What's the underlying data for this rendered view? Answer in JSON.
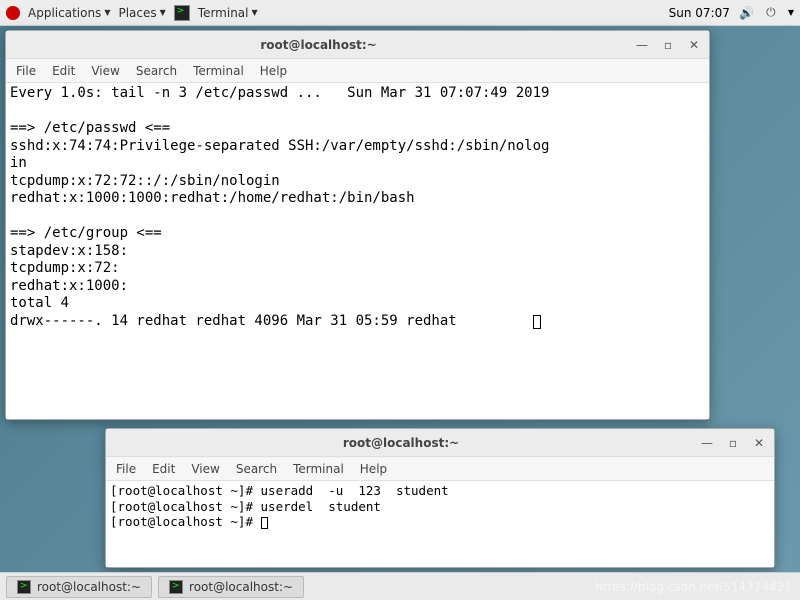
{
  "topbar": {
    "applications": "Applications",
    "places": "Places",
    "terminal": "Terminal",
    "clock": "Sun 07:07"
  },
  "window1": {
    "title": "root@localhost:~",
    "menus": {
      "file": "File",
      "edit": "Edit",
      "view": "View",
      "search": "Search",
      "terminal": "Terminal",
      "help": "Help"
    },
    "output": "Every 1.0s: tail -n 3 /etc/passwd ...   Sun Mar 31 07:07:49 2019\n\n==> /etc/passwd <==\nsshd:x:74:74:Privilege-separated SSH:/var/empty/sshd:/sbin/nolog\nin\ntcpdump:x:72:72::/:/sbin/nologin\nredhat:x:1000:1000:redhat:/home/redhat:/bin/bash\n\n==> /etc/group <==\nstapdev:x:158:\ntcpdump:x:72:\nredhat:x:1000:\ntotal 4\ndrwx------. 14 redhat redhat 4096 Mar 31 05:59 redhat"
  },
  "window2": {
    "title": "root@localhost:~",
    "menus": {
      "file": "File",
      "edit": "Edit",
      "view": "View",
      "search": "Search",
      "terminal": "Terminal",
      "help": "Help"
    },
    "output": "[root@localhost ~]# useradd  -u  123  student\n[root@localhost ~]# userdel  student\n[root@localhost ~]# "
  },
  "taskbar": {
    "item1": "root@localhost:~",
    "item2": "root@localhost:~"
  },
  "watermark": "https://blog.csdn.net/514774421"
}
